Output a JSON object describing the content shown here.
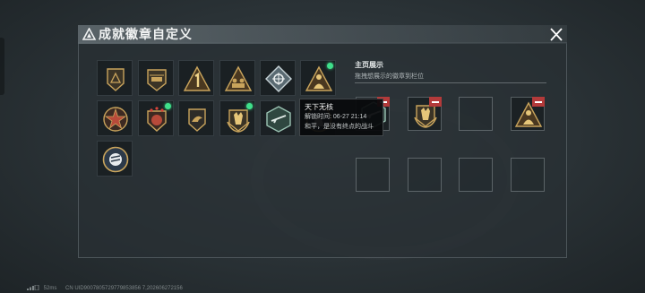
{
  "window": {
    "title": "成就徽章自定义",
    "close_icon": "close-icon"
  },
  "badges": [
    {
      "id": "badge-1",
      "emblem": "triangle-shield",
      "is_new": false
    },
    {
      "id": "badge-2",
      "emblem": "helicopter-shield",
      "is_new": false
    },
    {
      "id": "badge-3",
      "emblem": "number-one-triangle",
      "is_new": false
    },
    {
      "id": "badge-4",
      "emblem": "soldiers-triangle",
      "is_new": false
    },
    {
      "id": "badge-5",
      "emblem": "crosshair-diamond",
      "is_new": false
    },
    {
      "id": "badge-6",
      "emblem": "soldier-triangle",
      "is_new": true
    },
    {
      "id": "badge-7",
      "emblem": "star-medal",
      "is_new": false
    },
    {
      "id": "badge-8",
      "emblem": "stars-crest",
      "is_new": true
    },
    {
      "id": "badge-9",
      "emblem": "eagle-shield",
      "is_new": false
    },
    {
      "id": "badge-10",
      "emblem": "wolf-laurel",
      "is_new": true
    },
    {
      "id": "badge-11",
      "emblem": "rifle-hexagon",
      "is_new": false
    },
    {
      "id": "badge-12",
      "emblem": "horse-circle",
      "is_new": false
    },
    {
      "id": "badge-13",
      "emblem": "tank-circle",
      "is_new": false
    }
  ],
  "tooltip": {
    "name": "天下无核",
    "unlock_label": "解锁时间:",
    "unlock_time": "06-27 21:14",
    "description": "和平，是没有终点的战斗"
  },
  "showcase": {
    "title": "主页展示",
    "subtitle": "拖拽想展示的徽章到栏位",
    "slots": [
      {
        "filled": true,
        "emblem": "rifle-hexagon"
      },
      {
        "filled": true,
        "emblem": "wolf-laurel"
      },
      {
        "filled": false
      },
      {
        "filled": true,
        "emblem": "soldier-triangle"
      },
      {
        "filled": false
      },
      {
        "filled": false
      },
      {
        "filled": false
      },
      {
        "filled": false
      }
    ]
  },
  "status_bar": {
    "latency": "52ms",
    "build_info": "CN UID9007805729779853856 7,202606272156"
  },
  "colors": {
    "gold": "#c9a45c",
    "dark_gold": "#7a5f2c",
    "new_dot": "#3fe08b",
    "remove": "#b33a3a"
  }
}
